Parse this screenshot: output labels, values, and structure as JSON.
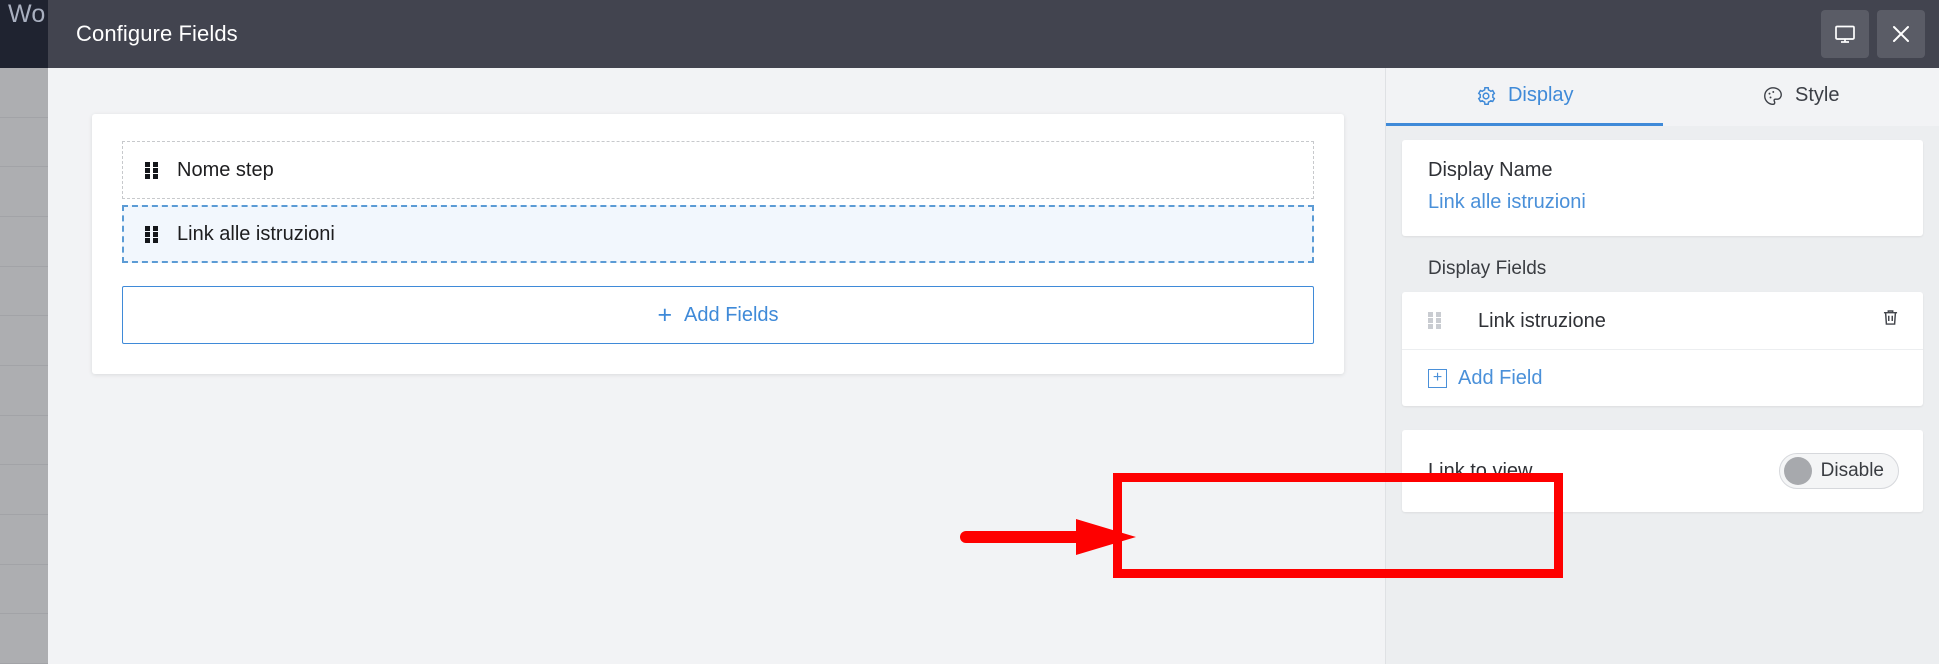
{
  "background": {
    "topbar_label": "Wo",
    "sidebar_row_count": 12
  },
  "modal": {
    "title": "Configure Fields",
    "header_actions": [
      {
        "name": "preview-monitor-icon",
        "label": "Preview"
      },
      {
        "name": "close-icon",
        "label": "Close"
      }
    ]
  },
  "main": {
    "fields": [
      {
        "label": "Nome step",
        "state": "inactive"
      },
      {
        "label": "Link alle istruzioni",
        "state": "active"
      }
    ],
    "add_fields_label": "Add Fields",
    "add_fields_plus": "+"
  },
  "right_panel": {
    "tabs": [
      {
        "label": "Display",
        "icon": "gear-icon",
        "active": true
      },
      {
        "label": "Style",
        "icon": "palette-icon",
        "active": false
      }
    ],
    "display_name": {
      "label": "Display Name",
      "value": "Link alle istruzioni"
    },
    "display_fields": {
      "title": "Display Fields",
      "items": [
        {
          "label": "Link istruzione",
          "delete_icon": "trash-icon"
        }
      ],
      "add_field_label": "Add Field",
      "add_field_plus": "+"
    },
    "link_to_view": {
      "label": "Link to view",
      "toggle_state_label": "Disable",
      "enabled": false
    }
  },
  "annotations": {
    "highlight_color": "#fe0000",
    "arrow_color": "#fe0000",
    "target": "Link to view"
  },
  "colors": {
    "header_bg": "#42444f",
    "accent_blue": "#3f8ad8",
    "link_blue": "#4a90d9",
    "panel_bg": "#eceef0",
    "page_bg": "#f2f3f5",
    "annotation_red": "#fe0000"
  }
}
